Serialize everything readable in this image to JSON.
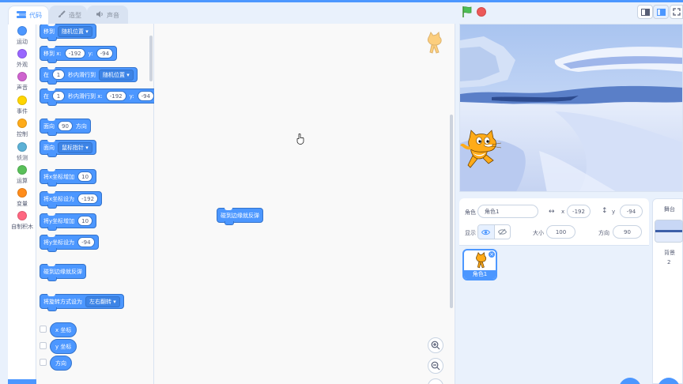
{
  "tabs": [
    {
      "label": "代码",
      "icon": "code-icon"
    },
    {
      "label": "造型",
      "icon": "brush-icon"
    },
    {
      "label": "声音",
      "icon": "speaker-icon"
    }
  ],
  "categories": [
    {
      "label": "运动",
      "color": "#4c97ff"
    },
    {
      "label": "外观",
      "color": "#9966ff"
    },
    {
      "label": "声音",
      "color": "#cf63cf"
    },
    {
      "label": "事件",
      "color": "#ffd500"
    },
    {
      "label": "控制",
      "color": "#ffab19"
    },
    {
      "label": "侦测",
      "color": "#5cb1d6"
    },
    {
      "label": "运算",
      "color": "#59c059"
    },
    {
      "label": "变量",
      "color": "#ff8c1a"
    },
    {
      "label": "自制积木",
      "color": "#ff6680"
    }
  ],
  "blocks": {
    "goto": {
      "label": "移到",
      "dropdown": "随机位置"
    },
    "gotoxy": {
      "label": "移到 x:",
      "x": "-192",
      "ylabel": "y:",
      "y": "-94"
    },
    "glide": {
      "prefix": "在",
      "secs": "1",
      "mid": "秒内滑行到",
      "dropdown": "随机位置"
    },
    "glidexy": {
      "prefix": "在",
      "secs": "1",
      "mid": "秒内滑行到 x:",
      "x": "-192",
      "ylabel": "y:",
      "y": "-94"
    },
    "pointdir": {
      "label": "面向",
      "value": "90",
      "suffix": "方向"
    },
    "pointtowards": {
      "label": "面向",
      "dropdown": "鼠标指针"
    },
    "changex": {
      "label": "将x坐标增加",
      "value": "10"
    },
    "setx": {
      "label": "将x坐标设为",
      "value": "-192"
    },
    "changey": {
      "label": "将y坐标增加",
      "value": "10"
    },
    "sety": {
      "label": "将y坐标设为",
      "value": "-94"
    },
    "bounce": {
      "label": "碰到边缘就反弹"
    },
    "rotstyle": {
      "label": "将旋转方式设为",
      "dropdown": "左右翻转"
    },
    "xpos": {
      "label": "x 坐标"
    },
    "ypos": {
      "label": "y 坐标"
    },
    "direction": {
      "label": "方向"
    }
  },
  "workspace": {
    "block_label": "碰到边缘就反弹"
  },
  "sprite_info": {
    "sprite_label": "角色",
    "sprite_name": "角色1",
    "x_label": "x",
    "x_value": "-192",
    "y_label": "y",
    "y_value": "-94",
    "show_label": "显示",
    "size_label": "大小",
    "size_value": "100",
    "direction_label": "方向",
    "direction_value": "90"
  },
  "sprite_list": [
    {
      "name": "角色1"
    }
  ],
  "stage_panel": {
    "title": "舞台",
    "backdrops_label": "背景",
    "backdrops_count": "2"
  },
  "colors": {
    "motion": "#4c97ff",
    "accent": "#4c97ff",
    "stop": "#ec5959",
    "flag": "#4cbf56"
  }
}
